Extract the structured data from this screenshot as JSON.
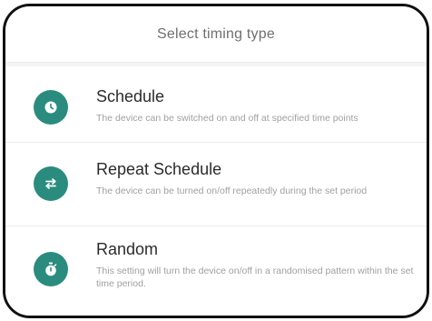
{
  "header": {
    "title": "Select timing type"
  },
  "options": [
    {
      "title": "Schedule",
      "description": "The device can be switched on and off at specified time points",
      "icon": "clock-icon"
    },
    {
      "title": "Repeat Schedule",
      "description": "The device can be turned on/off repeatedly during the set period",
      "icon": "repeat-arrows-icon"
    },
    {
      "title": "Random",
      "description": "This setting will turn the device on/off in a  randomised pattern within the set time period.",
      "icon": "stopwatch-icon"
    }
  ],
  "colors": {
    "accent": "#2a8c7e",
    "title_text": "#2b2b2b",
    "secondary_text": "#a0a0a0",
    "header_text": "#6f6f6f"
  }
}
